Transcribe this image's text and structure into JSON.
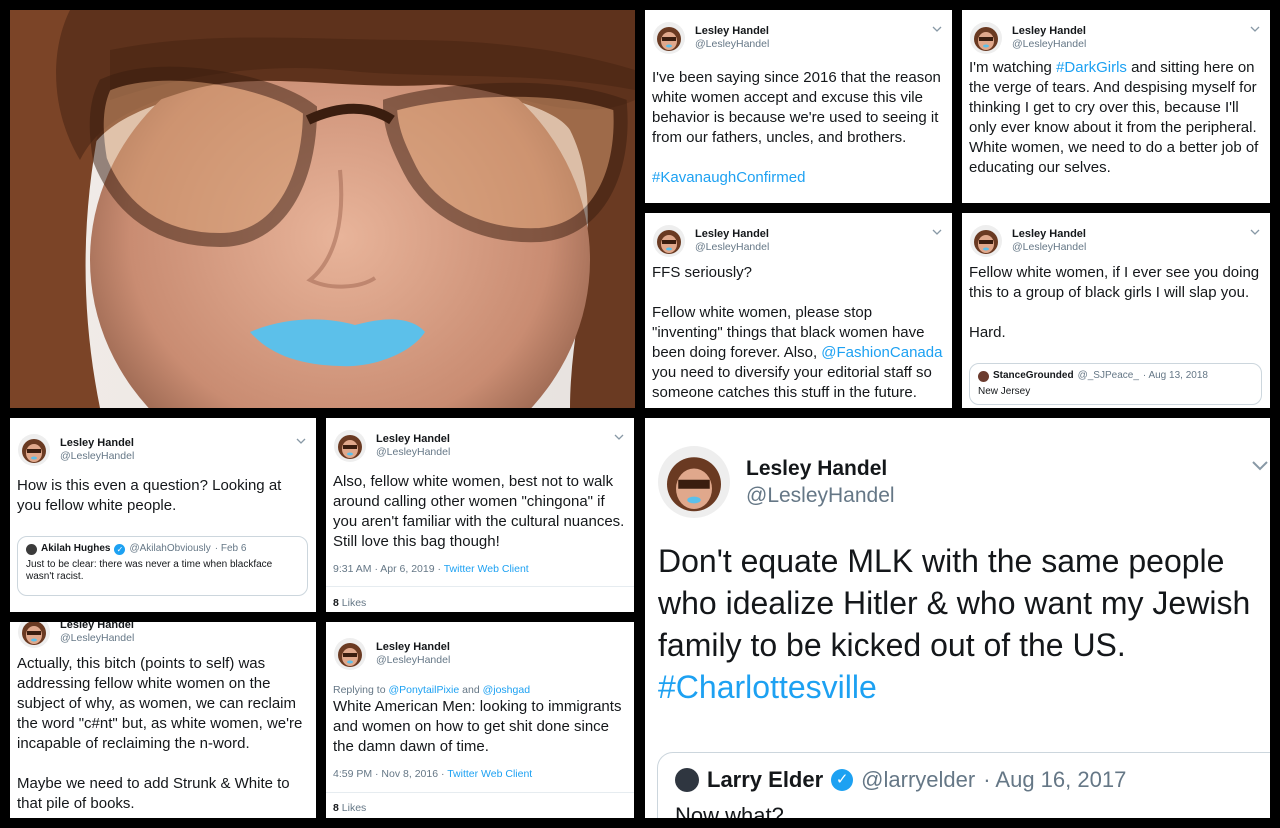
{
  "profile": {
    "name": "Lesley Handel",
    "handle": "@LesleyHandel"
  },
  "colors": {
    "link": "#1da1f2",
    "muted": "#657786",
    "lipstick": "#5cc0ea"
  },
  "tweets": {
    "t1": {
      "text": "I've been saying since 2016 that the reason white women accept and excuse this vile behavior is because we're used to seeing it from our fathers, uncles, and brothers.",
      "hashtag": "#KavanaughConfirmed"
    },
    "t2": {
      "pre": "I'm watching ",
      "hashtag": "#DarkGirls",
      "post": " and sitting here on the verge of tears. And despising myself for thinking I get to cry over this, because I'll only ever know about it from the peripheral. White women, we need to do a better job of educating our selves."
    },
    "t3": {
      "line1": "FFS seriously?",
      "pre": "Fellow white women, please stop \"inventing\" things that black women have been doing forever. Also, ",
      "mention": "@FashionCanada",
      "post": " you need to diversify your editorial staff so someone catches this stuff in the future."
    },
    "t4": {
      "line1": "Fellow white women, if I ever see you doing this to a group of black girls I will slap you.",
      "line2": "Hard.",
      "quote": {
        "name": "StanceGrounded",
        "handle": "@_SJPeace_",
        "date": "· Aug 13, 2018",
        "text": "New Jersey"
      }
    },
    "t5": {
      "text": "How is this even a question? Looking at you fellow white people.",
      "quote": {
        "name": "Akilah Hughes",
        "handle": "@AkilahObviously",
        "date": "· Feb 6",
        "text": "Just to be clear: there was never a time when blackface wasn't racist."
      }
    },
    "t6": {
      "text": "Also, fellow white women, best not to walk around calling other women \"chingona\" if you aren't familiar with the cultural nuances. Still love this bag though!",
      "time": "9:31 AM · Apr 6, 2019 · ",
      "client": "Twitter Web Client",
      "likes_count": "8",
      "likes_label": "Likes"
    },
    "t7": {
      "name": "Lesley Handel",
      "handle": "@LesleyHandel",
      "text1": "Actually, this bitch (points to self) was addressing fellow white women on the subject of why, as women, we can reclaim the word \"c#nt\" but, as white women, we're incapable of reclaiming the n-word.",
      "text2": "Maybe we need to add Strunk & White to that pile of books."
    },
    "t8": {
      "reply_prefix": "Replying to ",
      "reply_a": "@PonytailPixie",
      "reply_and": " and ",
      "reply_b": "@joshgad",
      "text": "White American Men: looking to immigrants and women on how to get shit done since the damn dawn of time.",
      "time": "4:59 PM · Nov 8, 2016 · ",
      "client": "Twitter Web Client",
      "likes_count": "8",
      "likes_label": "Likes"
    },
    "t9": {
      "text": "Don't equate MLK with the same people who idealize Hitler & who want my Jewish family to be kicked out of the US.",
      "hashtag": "#Charlottesville",
      "quote": {
        "name": "Larry Elder",
        "handle": "@larryelder",
        "date": "· Aug 16, 2017",
        "text": "Now what?"
      }
    }
  }
}
